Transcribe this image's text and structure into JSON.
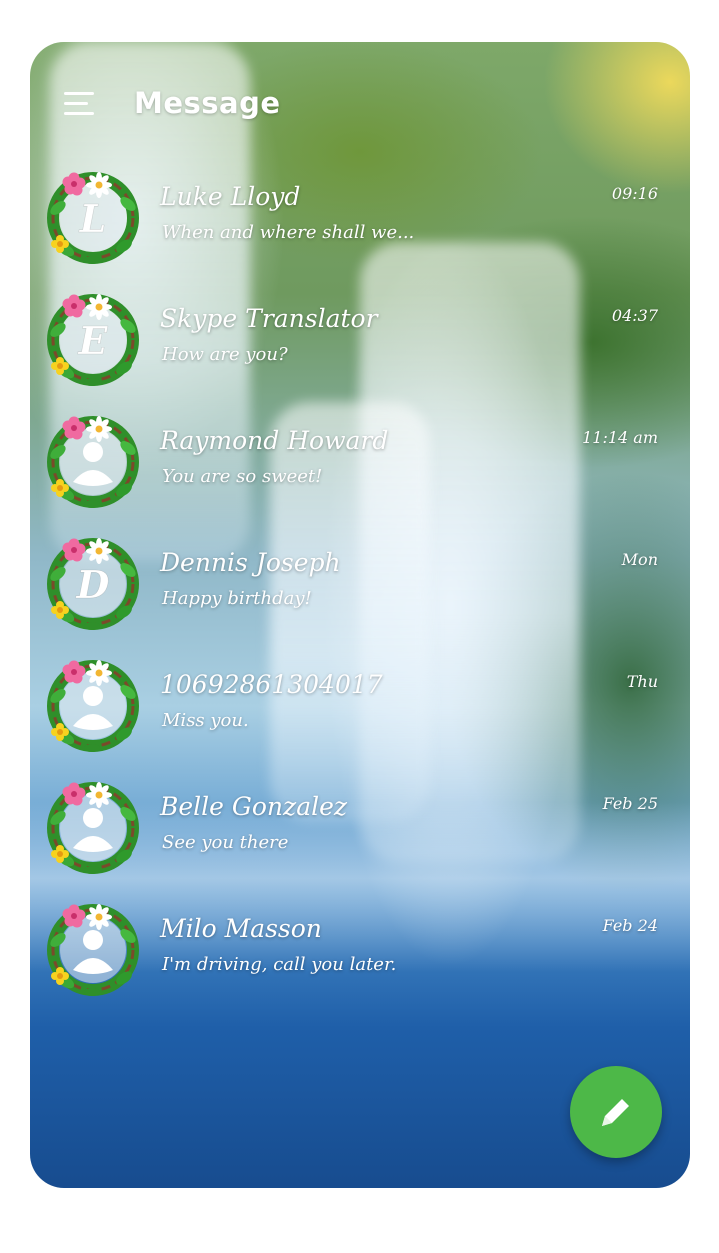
{
  "header": {
    "title": "Message"
  },
  "conversations": [
    {
      "initial": "L",
      "avatar_type": "letter",
      "name": "Luke Lloyd",
      "preview": "When and where shall we...",
      "time": "09:16"
    },
    {
      "initial": "E",
      "avatar_type": "letter",
      "name": "Skype Translator",
      "preview": "How are you?",
      "time": "04:37"
    },
    {
      "initial": "",
      "avatar_type": "person",
      "name": "Raymond Howard",
      "preview": "You are so sweet!",
      "time": "11:14 am"
    },
    {
      "initial": "D",
      "avatar_type": "letter",
      "name": "Dennis Joseph",
      "preview": "Happy birthday!",
      "time": "Mon"
    },
    {
      "initial": "",
      "avatar_type": "person",
      "name": "10692861304017",
      "preview": "Miss you.",
      "time": "Thu"
    },
    {
      "initial": "",
      "avatar_type": "person",
      "name": "Belle Gonzalez",
      "preview": "See you there",
      "time": "Feb 25"
    },
    {
      "initial": "",
      "avatar_type": "person",
      "name": "Milo Masson",
      "preview": "I'm driving, call you later.",
      "time": "Feb 24"
    }
  ],
  "icons": {
    "menu": "menu-icon",
    "compose": "pencil-icon",
    "person": "person-icon"
  },
  "colors": {
    "fab": "#4db848",
    "text": "#ffffff"
  }
}
